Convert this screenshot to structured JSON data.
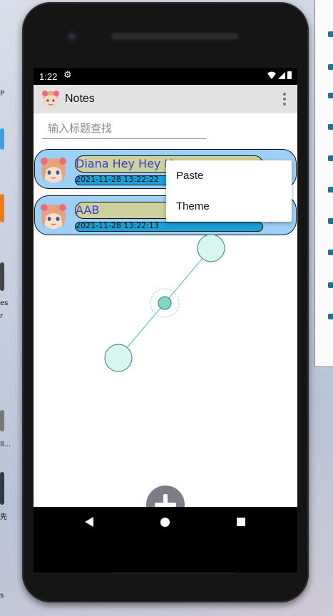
{
  "desktop": {
    "left_labels": [
      "P",
      "es",
      "r",
      "ll...",
      "先",
      "s"
    ],
    "right_panel_icon_count": 10
  },
  "status_bar": {
    "time": "1:22",
    "settings_icon": "gear-icon",
    "wifi_icon": "wifi-icon",
    "signal_icon": "signal-icon",
    "battery_icon": "battery-icon"
  },
  "app_bar": {
    "title": "Notes",
    "logo_icon": "anime-girl-avatar-icon",
    "overflow_icon": "more-vert-icon"
  },
  "search": {
    "placeholder": "输入标题查找",
    "value": ""
  },
  "overflow_menu": {
    "items": [
      {
        "label": "Paste"
      },
      {
        "label": "Theme"
      }
    ]
  },
  "notes": [
    {
      "title": "Diana Hey Hey Hey",
      "date": "2021-11-28 13:22:22",
      "avatar_icon": "anime-girl-avatar-icon"
    },
    {
      "title": "AAB",
      "date": "2021-11-28 13:22:13",
      "avatar_icon": "anime-girl-avatar-icon",
      "action_icon": "pencil-edit-icon"
    }
  ],
  "fab": {
    "icon": "plus-icon"
  },
  "nav_bar": {
    "back_icon": "back-triangle-icon",
    "home_icon": "home-circle-icon",
    "recent_icon": "recents-square-icon"
  },
  "colors": {
    "note_background": "#9ecff5",
    "title_box": "#cdd19e",
    "date_box": "#1a9fd6",
    "title_text": "#3b3bd4",
    "fab": "#7d7d88",
    "app_bar": "#e2e2e2",
    "joystick_fill": "#d8f5ef",
    "joystick_stroke": "#2e7d6d"
  }
}
